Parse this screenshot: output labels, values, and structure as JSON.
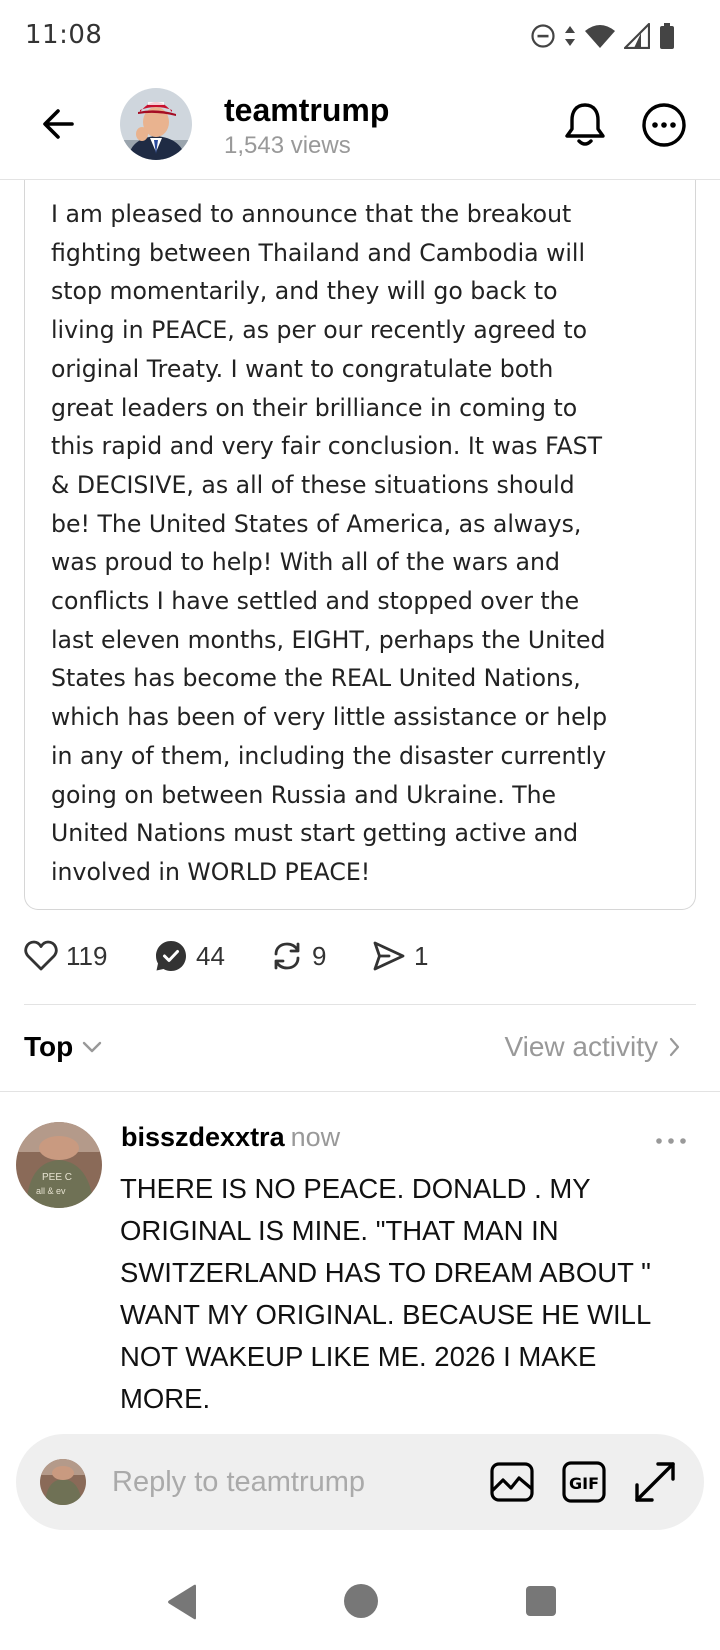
{
  "status_bar": {
    "time": "11:08",
    "icons": [
      "dnd-icon",
      "data-arrows-icon",
      "wifi-icon",
      "signal-icon",
      "battery-icon"
    ]
  },
  "header": {
    "back_icon": "back-arrow-icon",
    "username": "teamtrump",
    "views": "1,543 views",
    "bell_icon": "bell-icon",
    "more_icon": "more-circle-icon"
  },
  "post": {
    "lines": [
      "I am pleased to announce that the breakout",
      "fighting between Thailand and Cambodia will",
      "stop momentarily, and they will go back to",
      "living in PEACE, as per our recently agreed to",
      "original Treaty. I want to congratulate both",
      "great leaders on their brilliance in coming to",
      "this rapid and very fair conclusion. It was FAST",
      "& DECISIVE, as all of these situations should",
      "be! The United States of America, as always,",
      "was proud to help! With all of the wars and",
      "conflicts I have settled and stopped over the",
      "last eleven months, EIGHT, perhaps the United",
      "States has become the REAL United Nations,",
      "which has been of very little assistance or help",
      "in any of them, including the disaster currently",
      "going on between Russia and Ukraine. The",
      "United Nations must start getting active and",
      "involved in WORLD PEACE!"
    ]
  },
  "actions": {
    "likes": "119",
    "replies": "44",
    "reposts": "9",
    "shares": "1"
  },
  "sort": {
    "label": "Top",
    "view_activity": "View activity"
  },
  "comment": {
    "author": "bisszdexxtra",
    "time": "now",
    "lines": [
      "THERE IS NO PEACE. DONALD . MY",
      "ORIGINAL IS MINE. \"THAT MAN IN",
      "SWITZERLAND HAS TO DREAM ABOUT \"",
      "WANT MY ORIGINAL. BECAUSE HE WILL",
      "NOT WAKEUP LIKE ME. 2026 I MAKE",
      "MORE."
    ]
  },
  "reply": {
    "placeholder": "Reply to teamtrump",
    "value": ""
  },
  "colors": {
    "muted_text": "#999999",
    "divider": "#e3e3e3",
    "reply_bar_bg": "#efefef",
    "nav_gray": "#777777"
  }
}
